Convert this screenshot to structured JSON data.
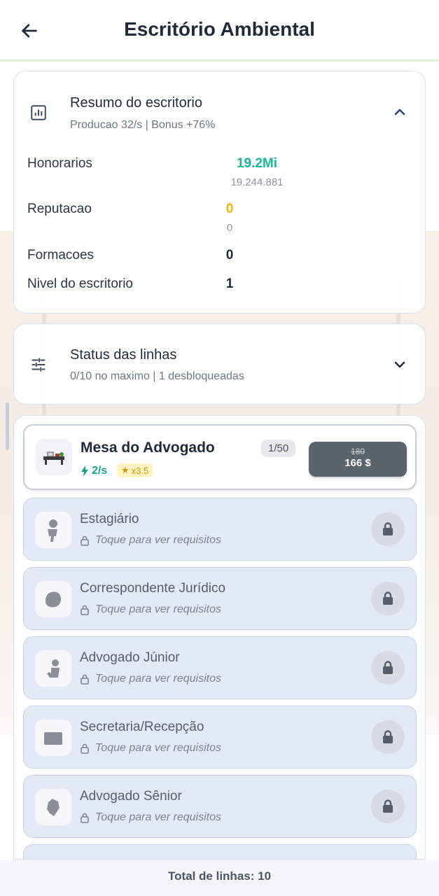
{
  "header": {
    "title": "Escritório Ambiental",
    "back_icon": "arrow-left-icon"
  },
  "resumo": {
    "title": "Resumo do escritorio",
    "subtitle": "Producao 32/s | Bonus +76%",
    "stats": {
      "honorarios": {
        "label": "Honorarios",
        "value": "19.2Mi",
        "sub": "19.244.881",
        "color": "#17b897"
      },
      "reputacao": {
        "label": "Reputacao",
        "value": "0",
        "sub": "0",
        "color": "#f2b400"
      },
      "formacoes": {
        "label": "Formacoes",
        "value": "0"
      },
      "nivel": {
        "label": "Nivel do escritorio",
        "value": "1"
      }
    }
  },
  "status": {
    "title": "Status das linhas",
    "subtitle": "0/10 no maximo | 1 desbloqueadas"
  },
  "active_line": {
    "name": "Mesa do Advogado",
    "level": "1/50",
    "rate": "2/s",
    "multiplier": "x3.5",
    "old_price": "180",
    "price": "166 $"
  },
  "locked_lines": [
    {
      "name": "Estagiário",
      "hint": "Toque para ver requisitos"
    },
    {
      "name": "Correspondente Jurídico",
      "hint": "Toque para ver requisitos"
    },
    {
      "name": "Advogado Júnior",
      "hint": "Toque para ver requisitos"
    },
    {
      "name": "Secretaria/Recepção",
      "hint": "Toque para ver requisitos"
    },
    {
      "name": "Advogado Sênior",
      "hint": "Toque para ver requisitos"
    }
  ],
  "footer": {
    "total": "Total de linhas: 10"
  }
}
